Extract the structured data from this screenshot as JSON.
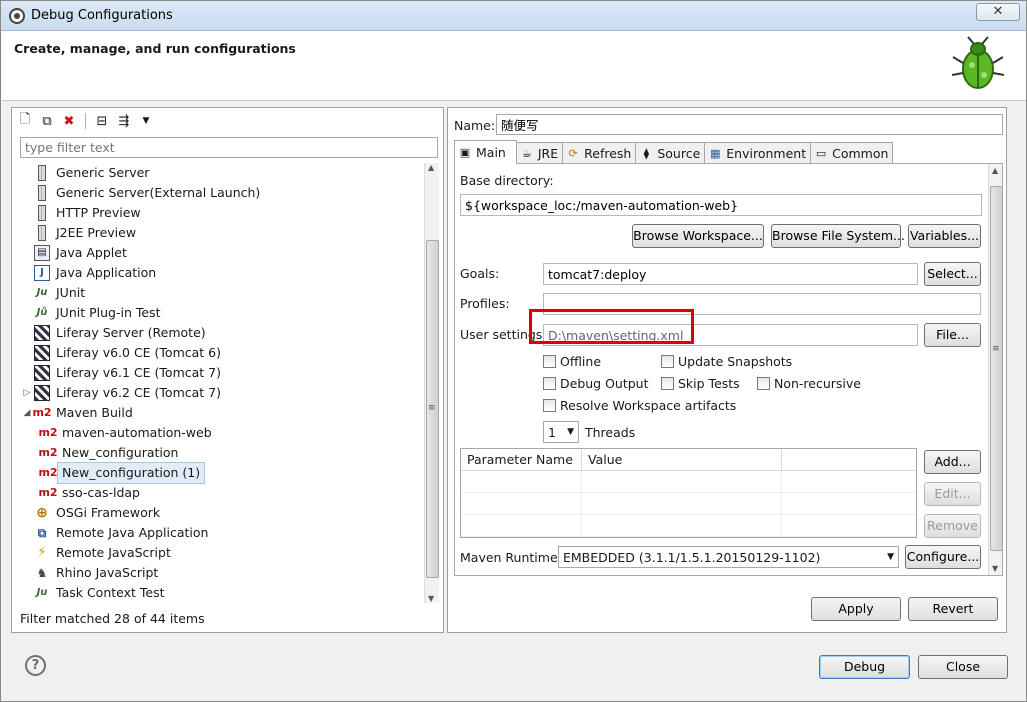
{
  "window": {
    "title": "Debug Configurations",
    "close": "✕"
  },
  "header": {
    "heading": "Create, manage, and run configurations"
  },
  "filter": {
    "placeholder": "type filter text"
  },
  "tree": {
    "items": [
      {
        "label": "Generic Server",
        "icon": "server-icon"
      },
      {
        "label": "Generic Server(External Launch)",
        "icon": "server-icon"
      },
      {
        "label": "HTTP Preview",
        "icon": "server-icon"
      },
      {
        "label": "J2EE Preview",
        "icon": "server-icon"
      },
      {
        "label": "Java Applet",
        "icon": "applet-icon"
      },
      {
        "label": "Java Application",
        "icon": "java-application-icon"
      },
      {
        "label": "JUnit",
        "icon": "junit-icon"
      },
      {
        "label": "JUnit Plug-in Test",
        "icon": "junit-plugin-icon"
      },
      {
        "label": "Liferay Server (Remote)",
        "icon": "liferay-icon"
      },
      {
        "label": "Liferay v6.0 CE (Tomcat 6)",
        "icon": "liferay-icon"
      },
      {
        "label": "Liferay v6.1 CE (Tomcat 7)",
        "icon": "liferay-icon"
      },
      {
        "label": "Liferay v6.2 CE (Tomcat 7)",
        "icon": "liferay-icon"
      },
      {
        "label": "Maven Build",
        "icon": "maven-icon"
      },
      {
        "label": "maven-automation-web",
        "icon": "maven-icon"
      },
      {
        "label": "New_configuration",
        "icon": "maven-icon"
      },
      {
        "label": "New_configuration (1)",
        "icon": "maven-icon"
      },
      {
        "label": "sso-cas-ldap",
        "icon": "maven-icon"
      },
      {
        "label": "OSGi Framework",
        "icon": "osgi-icon"
      },
      {
        "label": "Remote Java Application",
        "icon": "remote-java-icon"
      },
      {
        "label": "Remote JavaScript",
        "icon": "remote-javascript-icon"
      },
      {
        "label": "Rhino JavaScript",
        "icon": "rhino-icon"
      },
      {
        "label": "Task Context Test",
        "icon": "task-context-icon"
      }
    ]
  },
  "status": {
    "text": "Filter matched 28 of 44 items"
  },
  "config": {
    "name_label": "Name:",
    "name_value": "随便写",
    "tabs": [
      "Main",
      "JRE",
      "Refresh",
      "Source",
      "Environment",
      "Common"
    ],
    "base_dir_label": "Base directory:",
    "base_dir_value": "${workspace_loc:/maven-automation-web}",
    "browse_workspace": "Browse Workspace...",
    "browse_fs": "Browse File System...",
    "variables": "Variables...",
    "goals_label": "Goals:",
    "goals_value": "tomcat7:deploy",
    "select": "Select...",
    "profiles_label": "Profiles:",
    "profiles_value": "",
    "user_settings_label": "User settings:",
    "user_settings_value": "D:\\maven\\setting.xml",
    "file": "File...",
    "checks": {
      "offline": "Offline",
      "update_snapshots": "Update Snapshots",
      "debug_output": "Debug Output",
      "skip_tests": "Skip Tests",
      "non_recursive": "Non-recursive",
      "resolve_workspace": "Resolve Workspace artifacts"
    },
    "threads_value": "1",
    "threads_label": "Threads",
    "param_header_name": "Parameter Name",
    "param_header_value": "Value",
    "add": "Add...",
    "edit": "Edit...",
    "remove": "Remove",
    "runtime_label": "Maven Runtime:",
    "runtime_value": "EMBEDDED (3.1.1/1.5.1.20150129-1102)",
    "configure": "Configure...",
    "apply": "Apply",
    "revert": "Revert"
  },
  "footer": {
    "help": "?",
    "debug": "Debug",
    "close": "Close"
  }
}
